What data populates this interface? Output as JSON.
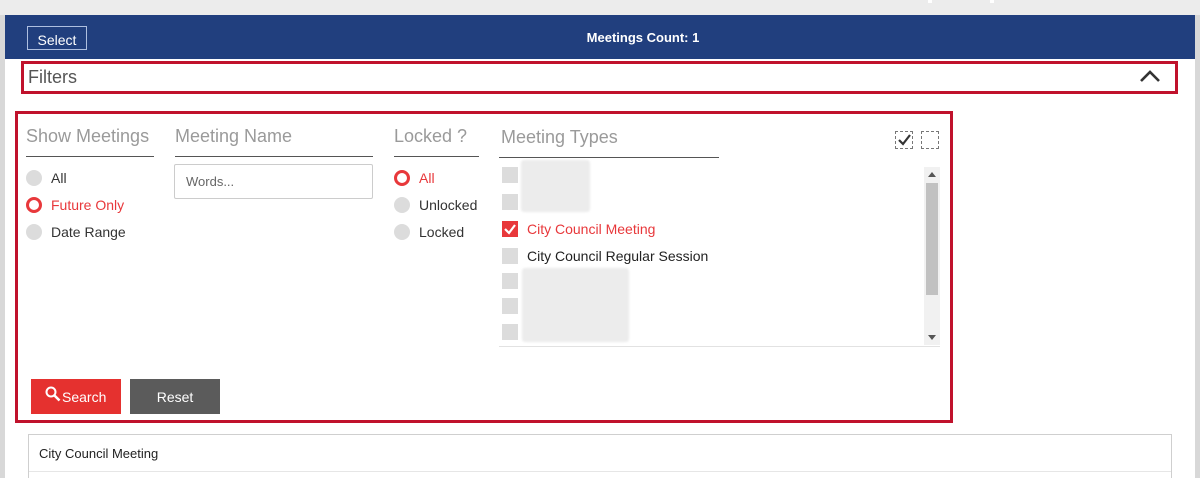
{
  "header": {
    "select_label": "Select",
    "meetings_count": "Meetings Count: 1",
    "bg_color": "#213f7e"
  },
  "filters": {
    "title": "Filters",
    "toggle_icon": "chevron-up-icon"
  },
  "show_meetings": {
    "heading": "Show Meetings",
    "options": [
      "All",
      "Future Only",
      "Date Range"
    ],
    "selected": "Future Only"
  },
  "meeting_name": {
    "heading": "Meeting Name",
    "placeholder": "Words...",
    "value": ""
  },
  "locked": {
    "heading": "Locked ?",
    "options": [
      "All",
      "Unlocked",
      "Locked"
    ],
    "selected": "All"
  },
  "meeting_types": {
    "heading": "Meeting Types",
    "select_all_icon": "check-all-icon",
    "clear_all_icon": "uncheck-all-icon",
    "items": [
      {
        "label": "City Council Meeting",
        "checked": true
      },
      {
        "label": "City Council Regular Session",
        "checked": false
      }
    ]
  },
  "actions": {
    "search_label": "Search",
    "search_icon": "magnifier-icon",
    "reset_label": "Reset"
  },
  "results": {
    "group_title": "City Council Meeting"
  },
  "colors": {
    "accent": "#e8383b",
    "highlight_border": "#c0122c",
    "reset_bg": "#5b5b5b"
  }
}
